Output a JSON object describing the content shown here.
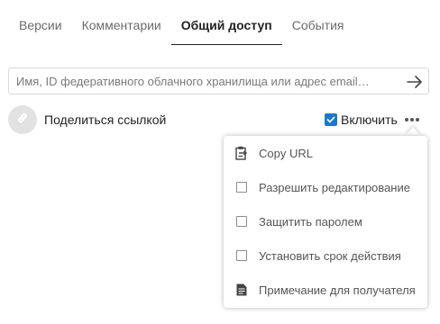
{
  "tabs": [
    {
      "label": "Версии",
      "active": false
    },
    {
      "label": "Комментарии",
      "active": false
    },
    {
      "label": "Общий доступ",
      "active": true
    },
    {
      "label": "События",
      "active": false
    }
  ],
  "share": {
    "placeholder": "Имя, ID федеративного облачного хранилища или адрес email…",
    "value": ""
  },
  "link_share": {
    "label": "Поделиться ссылкой",
    "enable_label": "Включить",
    "enabled": true
  },
  "menu": {
    "items": [
      {
        "label": "Copy URL",
        "icon": "clipboard-icon"
      },
      {
        "label": "Разрешить редактирование",
        "icon": "checkbox-icon",
        "checked": false
      },
      {
        "label": "Защитить паролем",
        "icon": "checkbox-icon",
        "checked": false
      },
      {
        "label": "Установить срок действия",
        "icon": "checkbox-icon",
        "checked": false
      },
      {
        "label": "Примечание для получателя",
        "icon": "note-icon"
      }
    ]
  },
  "colors": {
    "accent": "#1e78c8",
    "active_tab_border": "#222222",
    "muted_text": "#6b6b6b",
    "avatar_bg": "#e2e2e2"
  }
}
